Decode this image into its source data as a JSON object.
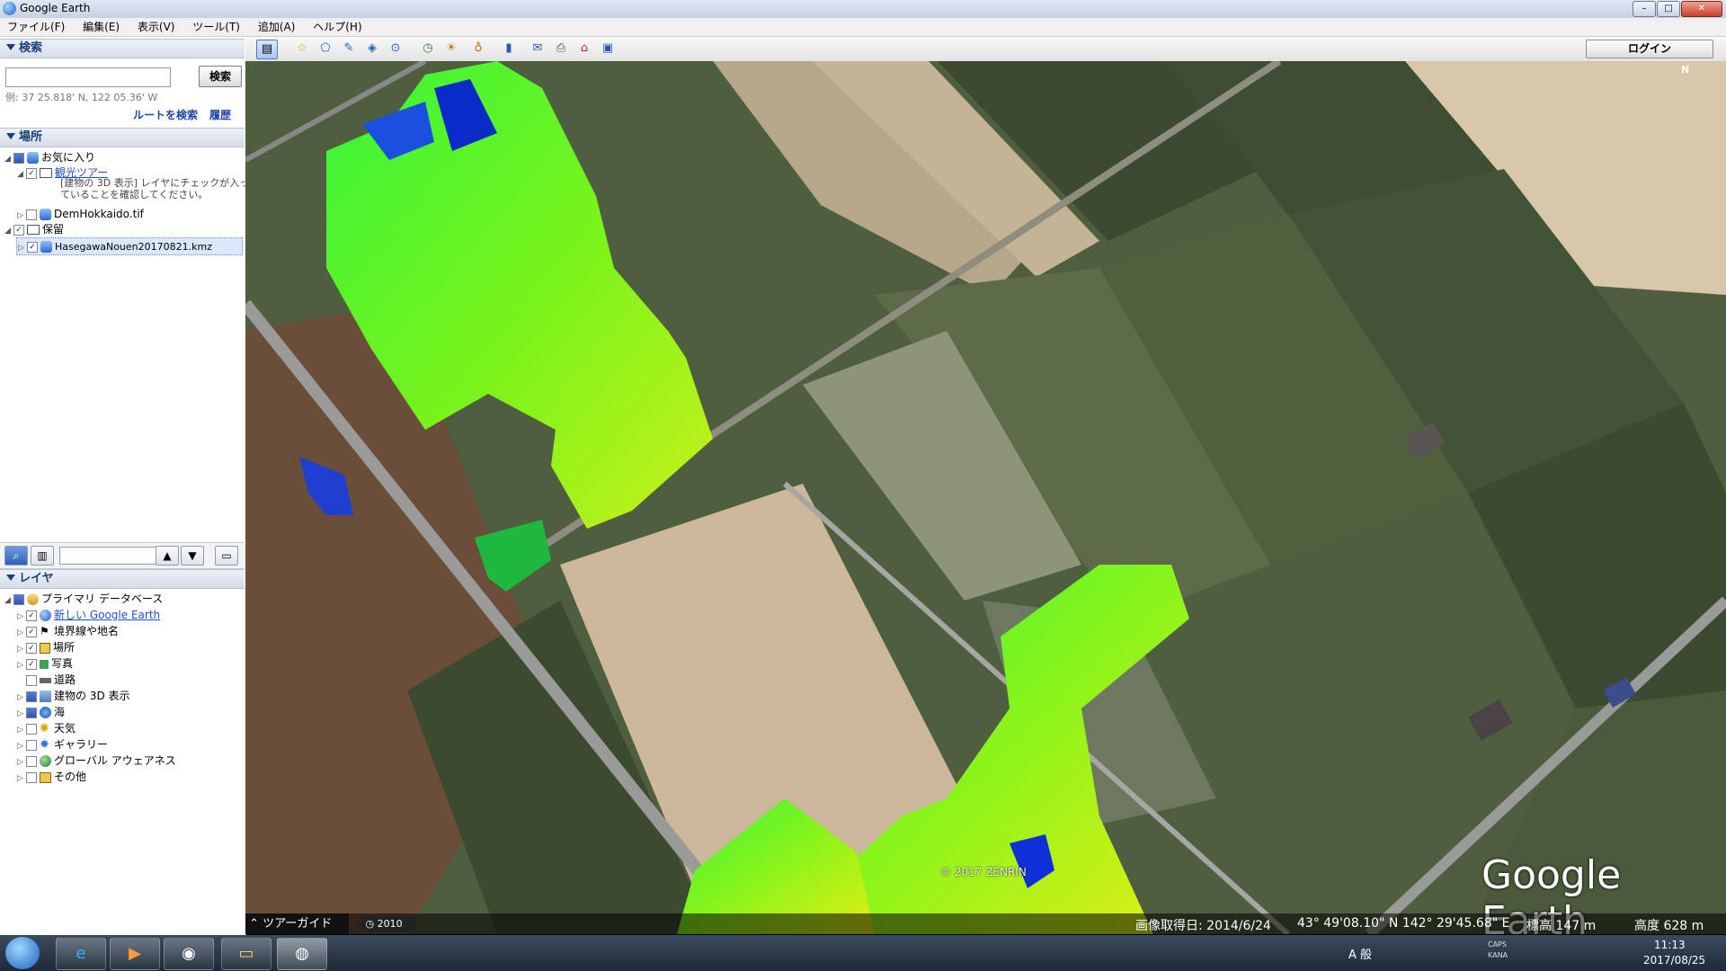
{
  "window": {
    "title": "Google Earth",
    "min": "–",
    "max": "□",
    "close": "✕"
  },
  "menu": [
    "ファイル(F)",
    "編集(E)",
    "表示(V)",
    "ツール(T)",
    "追加(A)",
    "ヘルプ(H)"
  ],
  "search": {
    "header": "検索",
    "button": "検索",
    "hint": "例: 37 25.818' N, 122 05.36' W",
    "route_link": "ルートを検索",
    "history_link": "履歴"
  },
  "places": {
    "header": "場所",
    "items": [
      {
        "label": "お気に入り"
      },
      {
        "label": "観光ツアー"
      },
      {
        "label": "[建物の 3D 表示] レイヤにチェックが入っ"
      },
      {
        "label": "ていることを確認してください。"
      },
      {
        "label": "DemHokkaido.tif"
      },
      {
        "label": "保留"
      },
      {
        "label": "HasegawaNouen20170821.kmz"
      }
    ]
  },
  "layers": {
    "header": "レイヤ",
    "items": [
      {
        "label": "プライマリ データベース"
      },
      {
        "label": "新しい Google Earth"
      },
      {
        "label": "境界線や地名"
      },
      {
        "label": "場所"
      },
      {
        "label": "写真"
      },
      {
        "label": "道路"
      },
      {
        "label": "建物の 3D 表示"
      },
      {
        "label": "海"
      },
      {
        "label": "天気"
      },
      {
        "label": "ギャラリー"
      },
      {
        "label": "グローバル アウェアネス"
      },
      {
        "label": "その他"
      }
    ]
  },
  "map_toolbar": {
    "login": "ログイン"
  },
  "map": {
    "copyright": "© 2017 ZENRIN",
    "brand": "Google Earth",
    "compass": "N"
  },
  "status": {
    "tour_guide": "ツアーガイド",
    "year": "2010",
    "image_date": "画像取得日: 2014/6/24",
    "coords": "43° 49'08.10\" N 142° 29'45.68\" E",
    "elevation": "標高  147 m",
    "altitude": "高度  628 m"
  },
  "taskbar": {
    "time": "11:13",
    "date": "2017/08/25",
    "ime": "A 般",
    "caps": "CAPS",
    "kana": "KANA"
  }
}
